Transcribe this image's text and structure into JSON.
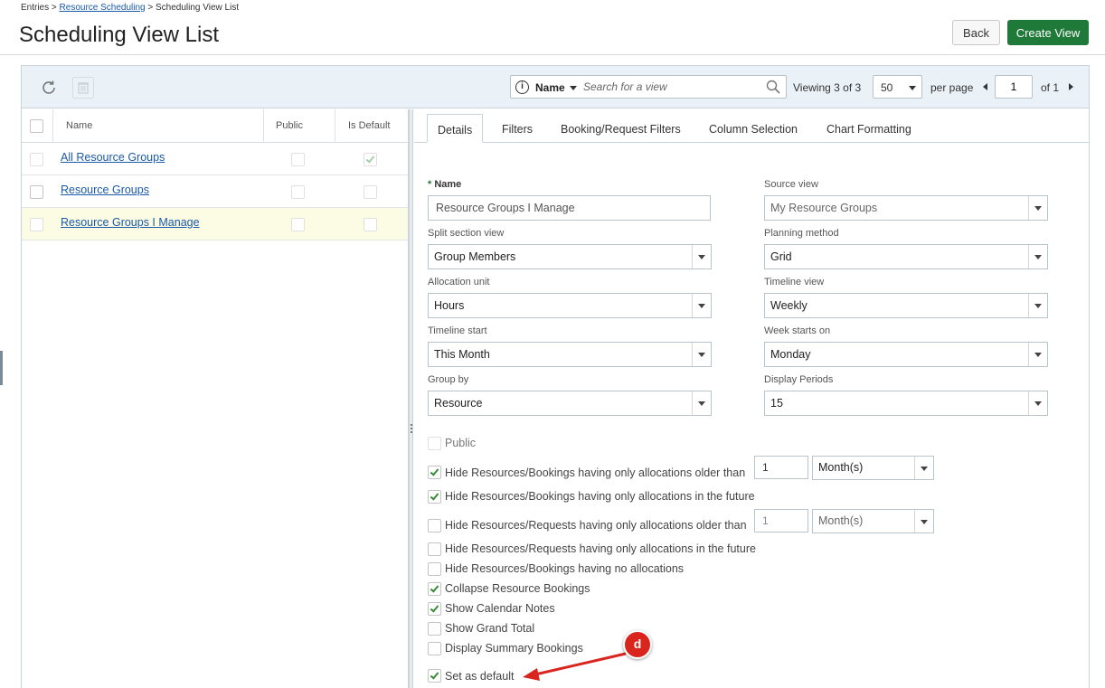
{
  "breadcrumb": {
    "root": "Entries",
    "sep1": ">",
    "parent": "Resource Scheduling",
    "sep2": ">",
    "current": "Scheduling View List"
  },
  "page_title": "Scheduling View List",
  "buttons": {
    "back": "Back",
    "create": "Create View"
  },
  "search": {
    "field": "Name",
    "placeholder": "Search for a view"
  },
  "paging": {
    "viewing_label": "Viewing",
    "viewing_count": "3 of 3",
    "per_page_value": "50",
    "per_page_label": "per page",
    "page": "1",
    "of_label": "of 1"
  },
  "list": {
    "columns": [
      "Name",
      "Public",
      "Is Default"
    ],
    "rows": [
      {
        "name": "All Resource Groups",
        "public": false,
        "is_default": true
      },
      {
        "name": "Resource Groups",
        "public": false,
        "is_default": false
      },
      {
        "name": "Resource Groups I Manage",
        "public": false,
        "is_default": false,
        "selected": true
      }
    ]
  },
  "tabs": [
    "Details",
    "Filters",
    "Booking/Request Filters",
    "Column Selection",
    "Chart Formatting"
  ],
  "form": {
    "name_label": "Name",
    "name_value": "Resource Groups I Manage",
    "source_view_label": "Source view",
    "source_view_value": "My Resource Groups",
    "split_section_label": "Split section view",
    "split_section_value": "Group Members",
    "planning_method_label": "Planning method",
    "planning_method_value": "Grid",
    "allocation_unit_label": "Allocation unit",
    "allocation_unit_value": "Hours",
    "timeline_view_label": "Timeline view",
    "timeline_view_value": "Weekly",
    "timeline_start_label": "Timeline start",
    "timeline_start_value": "This Month",
    "week_starts_label": "Week starts on",
    "week_starts_value": "Monday",
    "group_by_label": "Group by",
    "group_by_value": "Resource",
    "display_periods_label": "Display Periods",
    "display_periods_value": "15"
  },
  "options": [
    {
      "label": "Public",
      "checked": false,
      "disabled": true
    },
    {
      "label": "Hide Resources/Bookings having only allocations older than",
      "checked": true,
      "number": "1",
      "unit": "Month(s)"
    },
    {
      "label": "Hide Resources/Bookings having only allocations in the future",
      "checked": true
    },
    {
      "label": "Hide Resources/Requests having only allocations older than",
      "checked": false,
      "number": "1",
      "unit": "Month(s)"
    },
    {
      "label": "Hide Resources/Requests having only allocations in the future",
      "checked": false
    },
    {
      "label": "Hide Resources/Bookings having no allocations",
      "checked": false
    },
    {
      "label": "Collapse Resource Bookings",
      "checked": true
    },
    {
      "label": "Show Calendar Notes",
      "checked": true
    },
    {
      "label": "Show Grand Total",
      "checked": false
    },
    {
      "label": "Display Summary Bookings",
      "checked": false
    },
    {
      "label": "Set as default",
      "checked": true
    }
  ],
  "annotation": {
    "badge": "d",
    "color": "#d9251d"
  },
  "colors": {
    "accent_green": "#1f7a3a",
    "link_blue": "#1a5aa8",
    "toolbar_bg": "#eaf1f7",
    "selected_row": "#fcfbe3"
  },
  "icons": {
    "refresh": "refresh-icon",
    "delete": "trash-icon",
    "info": "info-icon",
    "search": "search-icon"
  }
}
